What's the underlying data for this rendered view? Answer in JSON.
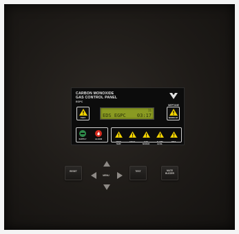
{
  "panel": {
    "title_line1": "CARBON MONOXIDE",
    "title_line2": "GAS CONTROL PANEL",
    "code": "EGPC",
    "brand": "NEPTUNE",
    "test_button_label": "TEST",
    "warmup_button_label": "WARM UP",
    "lcd": {
      "line1": "I1",
      "model": "EDS EGPC",
      "time": "03:17",
      "color": "#8a9a22"
    },
    "status_leds": [
      {
        "label": "SUPPLY",
        "color": "#2e8a4a",
        "icon": "supply-led-icon"
      },
      {
        "label": "ALARM",
        "color": "#d42a1e",
        "icon": "alarm-led-icon"
      }
    ],
    "alerts": [
      {
        "label": "OVER\nTEMP"
      },
      {
        "label": "FAULT"
      },
      {
        "label": "GAS\nSENSOR"
      },
      {
        "label": "ALARM\nLEVEL"
      },
      {
        "label": "AREA"
      }
    ]
  },
  "keypad": {
    "reset_label": "RESET",
    "menu_label": "MENU",
    "test_label": "TEST",
    "mute_label_line1": "MUTE",
    "mute_label_line2": "BUZZER"
  },
  "colors": {
    "warning_yellow": "#f5d400",
    "cabinet": "#1d1a17"
  }
}
